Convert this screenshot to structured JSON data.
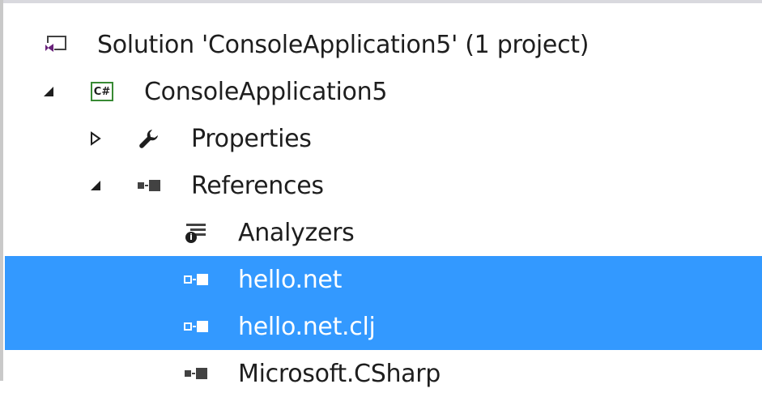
{
  "solution_explorer": {
    "selection_color": "#3399ff",
    "items": [
      {
        "label": "Solution 'ConsoleApplication5' (1 project)",
        "icon": "solution-icon"
      },
      {
        "label": "ConsoleApplication5",
        "icon": "csharp-project-icon",
        "expanded": true
      },
      {
        "label": "Properties",
        "icon": "wrench-icon",
        "expanded": false
      },
      {
        "label": "References",
        "icon": "references-icon",
        "expanded": true
      },
      {
        "label": "Analyzers",
        "icon": "analyzers-icon"
      },
      {
        "label": "hello.net",
        "icon": "reference-icon",
        "selected": true
      },
      {
        "label": "hello.net.clj",
        "icon": "reference-icon",
        "selected": true
      },
      {
        "label": "Microsoft.CSharp",
        "icon": "reference-icon"
      }
    ]
  }
}
